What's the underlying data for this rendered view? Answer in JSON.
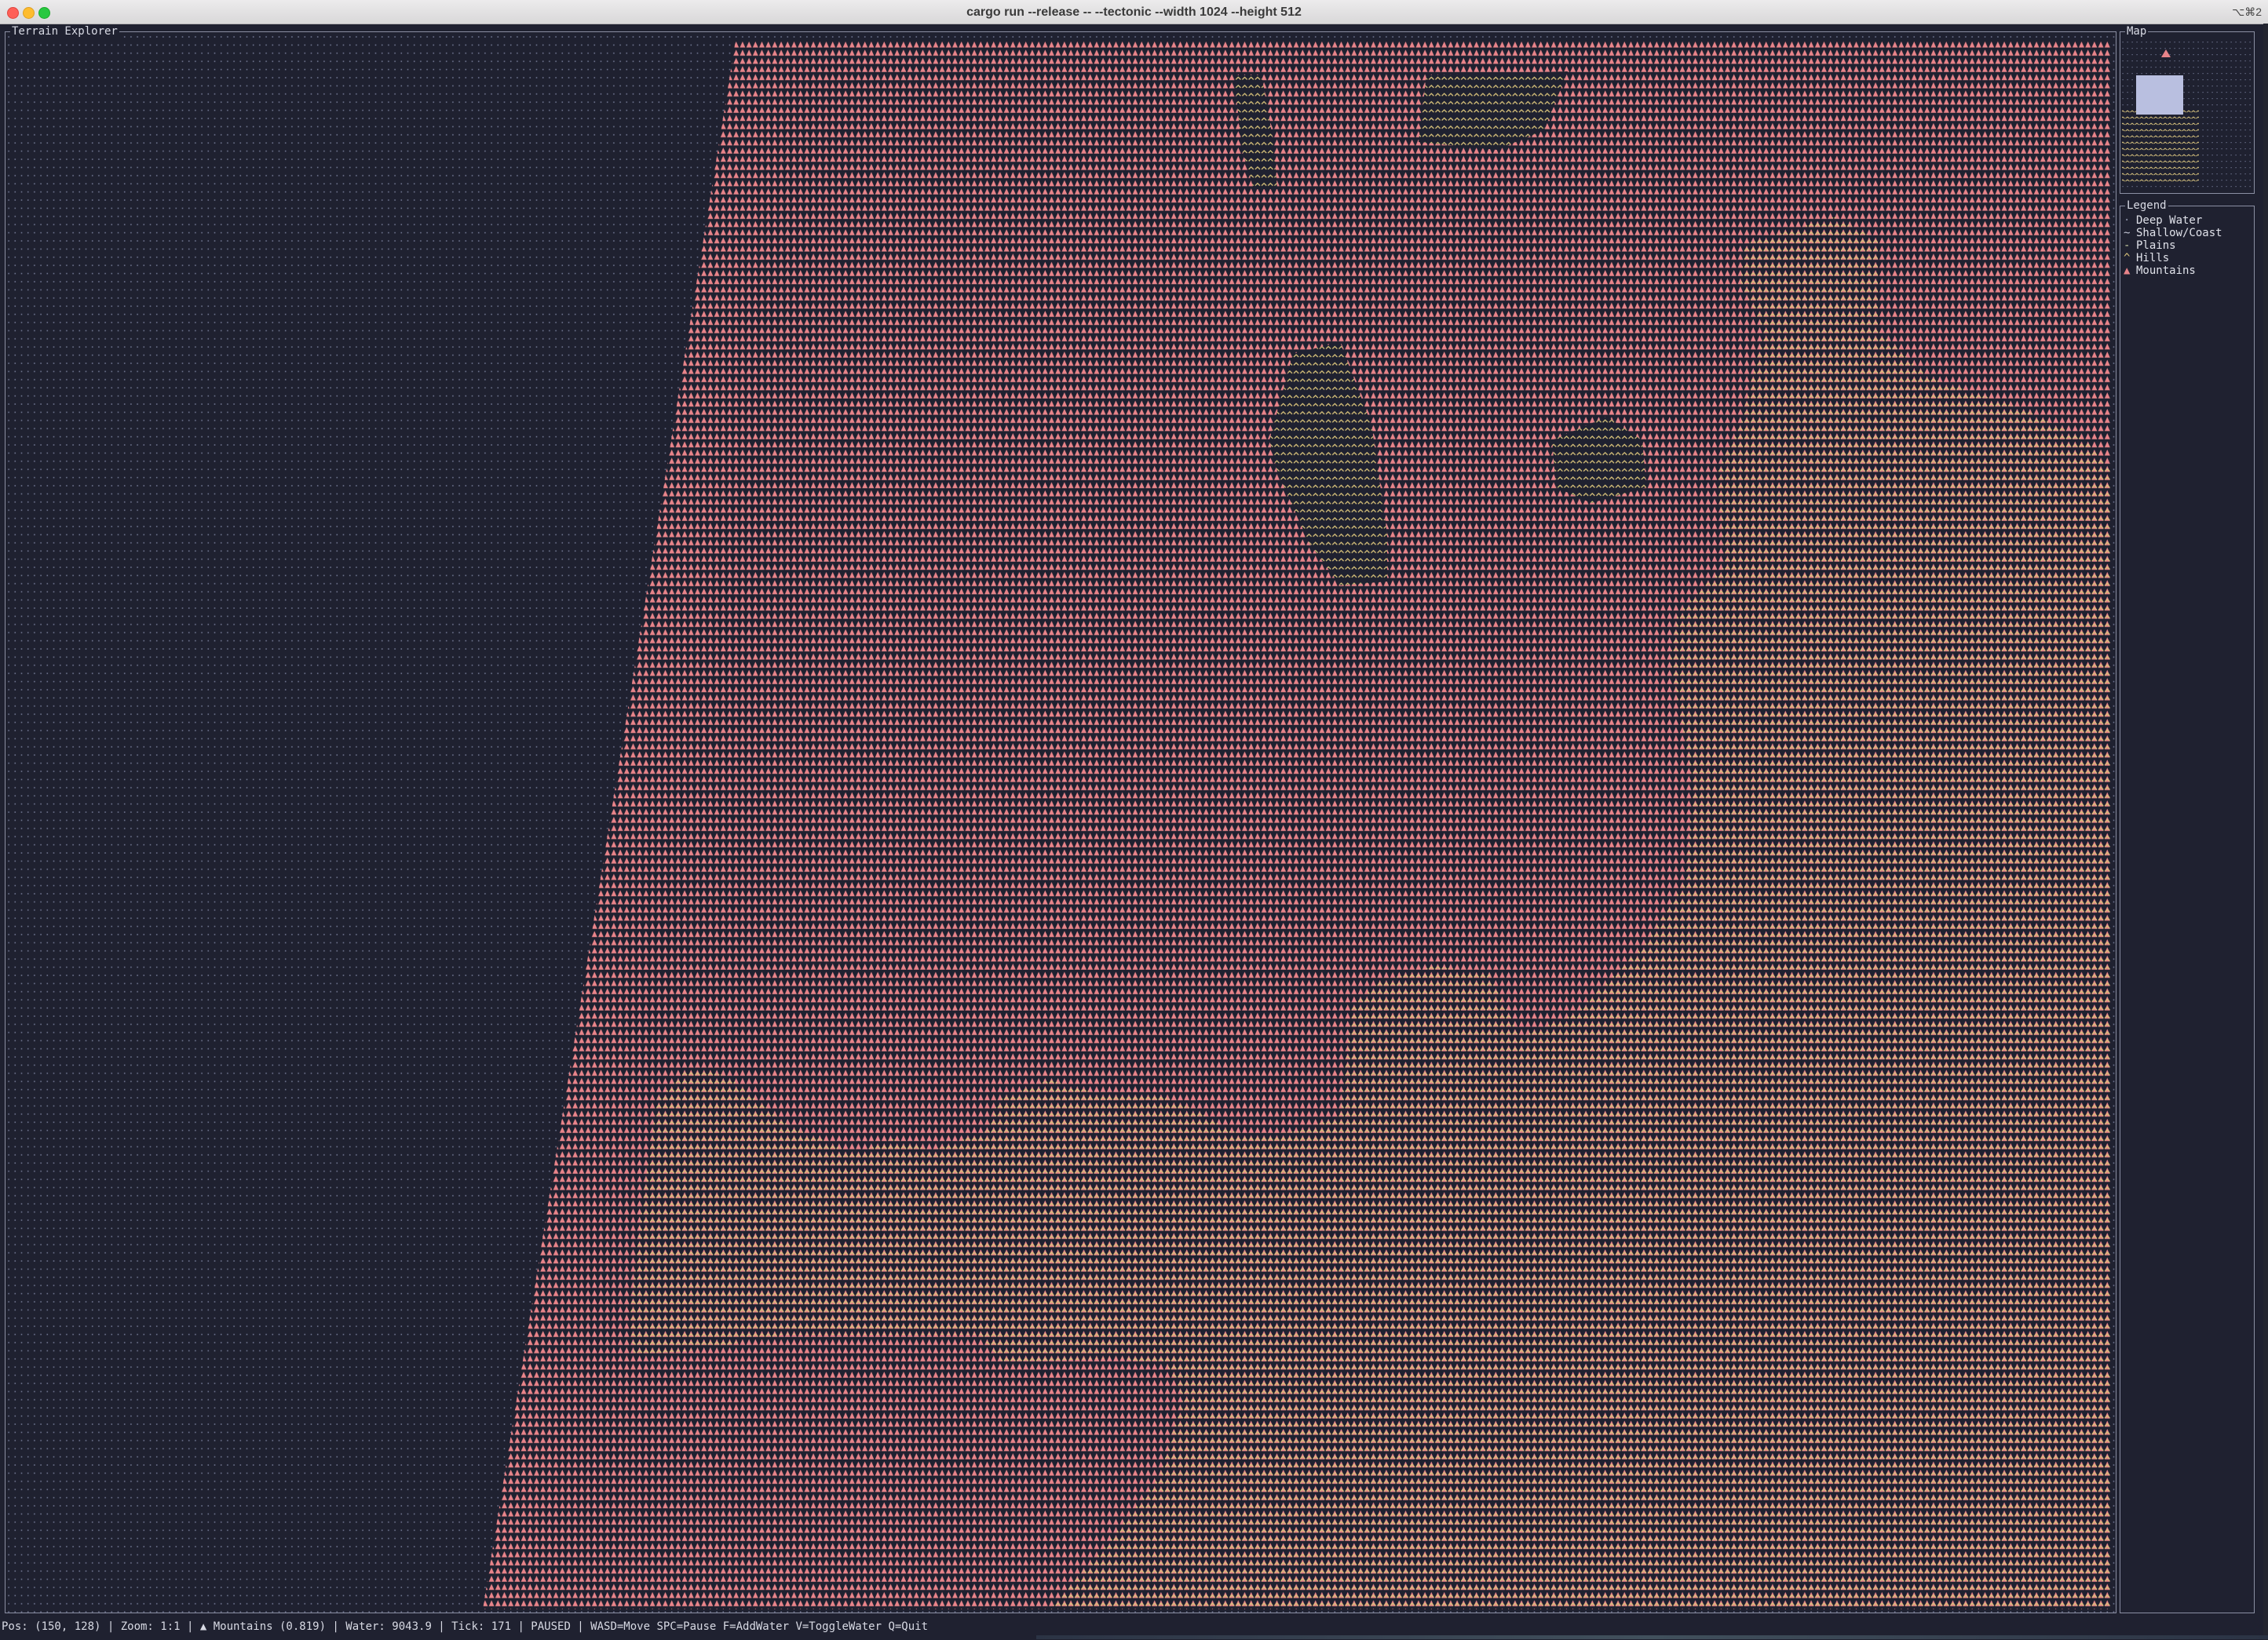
{
  "window": {
    "title": "cargo run --release -- --tectonic --width 1024 --height 512",
    "shortcut": "⌥⌘2"
  },
  "main_panel": {
    "title": "Terrain Explorer"
  },
  "map_panel": {
    "title": "Map"
  },
  "legend": {
    "title": "Legend",
    "items": [
      {
        "glyph": "·",
        "label": "Deep Water",
        "color": "#8a8fa6",
        "icon": "dot-icon"
      },
      {
        "glyph": "~",
        "label": "Shallow/Coast",
        "color": "#c3c6d6",
        "icon": "wave-icon"
      },
      {
        "glyph": "-",
        "label": "Plains",
        "color": "#c9cfa3",
        "icon": "dash-icon"
      },
      {
        "glyph": "^",
        "label": "Hills",
        "color": "#d8c27a",
        "icon": "caret-icon"
      },
      {
        "glyph": "▲",
        "label": "Mountains",
        "color": "#e8848a",
        "icon": "triangle-icon"
      }
    ]
  },
  "status": {
    "text": "Pos: (150, 128) | Zoom: 1:1 | ▲ Mountains (0.819) | Water: 9043.9 | Tick: 171 | PAUSED | WASD=Move SPC=Pause F=AddWater V=ToggleWater Q=Quit"
  },
  "colors": {
    "background": "#1f2130",
    "mountain": "#e8848a",
    "hills": "#d8c27a",
    "water_dot": "#6f7590",
    "panel_border": "#8b8fa3",
    "viewport_highlight": "#b9bfe0"
  }
}
